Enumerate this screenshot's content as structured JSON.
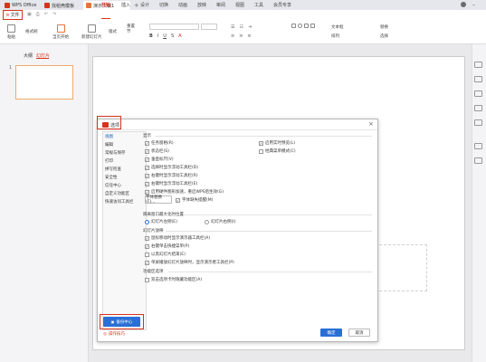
{
  "titlebar": {
    "tabs": [
      {
        "label": "WPS Office",
        "color": "#d9321d"
      },
      {
        "label": "找稻壳模板",
        "color": "#d9321d"
      },
      {
        "label": "演示文稿1",
        "color": "#e8733a"
      }
    ],
    "add": "+"
  },
  "ribbon": {
    "file_menu": "文件",
    "tabs": [
      "开始",
      "插入",
      "设计",
      "切换",
      "动画",
      "放映",
      "审阅",
      "视图",
      "工具",
      "会员专享"
    ],
    "active_tab": "开始"
  },
  "toolbar": {
    "items": [
      "粘贴",
      "格式刷",
      "当页开始",
      "新建幻灯片",
      "版式",
      "节",
      "重置",
      "文本框",
      "排列",
      "替换",
      "选择"
    ]
  },
  "left_panel": {
    "tabs": [
      "大纲",
      "幻灯片"
    ],
    "slide_number": "1"
  },
  "dialog": {
    "title": "选项",
    "close": "×",
    "nav": [
      "视图",
      "编辑",
      "常规与保存",
      "打印",
      "拼写检查",
      "安全性",
      "信任中心",
      "自定义功能区",
      "快速访问工具栏"
    ],
    "nav_selected": "视图",
    "display_header": "显示",
    "display_left": [
      {
        "label": "任务窗格(R)",
        "checked": true
      },
      {
        "label": "状态栏(S)",
        "checked": true
      },
      {
        "label": "垂直标尺(V)",
        "checked": true
      },
      {
        "label": "选择时显示浮动工具栏(D)",
        "checked": true
      },
      {
        "label": "右键时显示浮动工具栏(R)",
        "checked": true
      },
      {
        "label": "右键时显示浮动工具栏(E)",
        "checked": true
      },
      {
        "label": "启用硬件图形加速，重启WPS后生效(G)",
        "checked": true
      }
    ],
    "display_right": [
      {
        "label": "启用实时预览(L)",
        "checked": true
      },
      {
        "label": "经典菜单模式(C)",
        "checked": false
      }
    ],
    "font_button": "字体替换(F)...",
    "font_missing": {
      "label": "字体缺失提醒(M)",
      "checked": true
    },
    "maximize_header": "隔离窗口最大化时位置",
    "maximize_options": [
      {
        "label": "幻灯片左侧(E)",
        "on": true
      },
      {
        "label": "幻灯片右侧(I)",
        "on": false
      }
    ],
    "slideshow_header": "幻灯片放映",
    "slideshow_items": [
      {
        "label": "鼠标移动时显示演示器工具栏(A)",
        "checked": true
      },
      {
        "label": "右键单击快捷菜单(P)",
        "checked": true
      },
      {
        "label": "以黑幻灯片结束(E)",
        "checked": false
      },
      {
        "label": "单屏播放幻灯片放映时，显示演示者工具栏(P)",
        "checked": true
      }
    ],
    "ribbon_header": "功能区选项",
    "ribbon_items": [
      {
        "label": "双击选项卡时隐藏功能区(A)",
        "checked": false
      }
    ],
    "backup_button": "备份中心",
    "tips": "操作技巧",
    "ok": "确定",
    "cancel": "取消"
  },
  "colors": {
    "accent_red": "#d9321d",
    "primary_blue": "#2a6fd6"
  }
}
